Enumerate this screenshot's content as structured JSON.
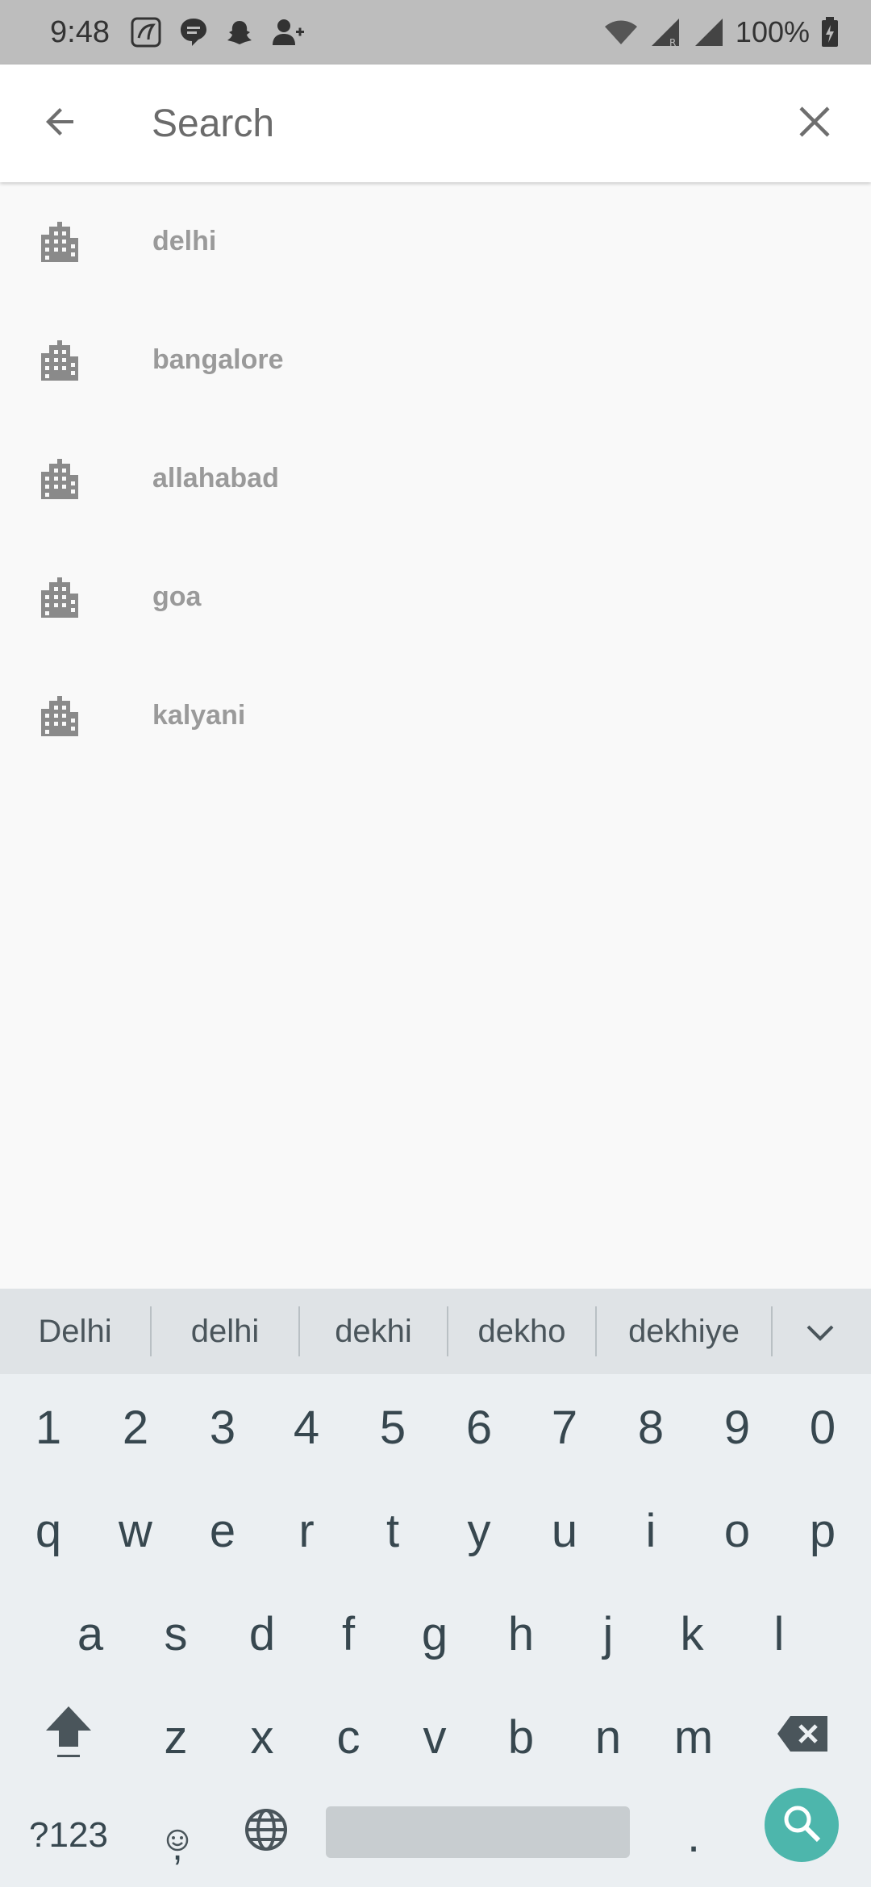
{
  "status_bar": {
    "time": "9:48",
    "battery_text": "100%",
    "left_icons": [
      "saavn-icon",
      "message-icon",
      "snapchat-icon",
      "add-contact-icon"
    ],
    "right_icons": [
      "wifi-icon",
      "signal-roaming-icon",
      "signal-icon",
      "battery-charging-icon"
    ]
  },
  "app_bar": {
    "search_placeholder": "Search",
    "search_value": "",
    "back_icon": "arrow-back-icon",
    "clear_icon": "close-icon"
  },
  "suggestions": [
    {
      "label": "delhi",
      "icon": "city-icon"
    },
    {
      "label": "bangalore",
      "icon": "city-icon"
    },
    {
      "label": "allahabad",
      "icon": "city-icon"
    },
    {
      "label": "goa",
      "icon": "city-icon"
    },
    {
      "label": "kalyani",
      "icon": "city-icon"
    }
  ],
  "keyboard": {
    "word_suggestions": [
      "Delhi",
      "delhi",
      "dekhi",
      "dekho",
      "dekhiye"
    ],
    "number_row": [
      "1",
      "2",
      "3",
      "4",
      "5",
      "6",
      "7",
      "8",
      "9",
      "0"
    ],
    "row1": [
      "q",
      "w",
      "e",
      "r",
      "t",
      "y",
      "u",
      "i",
      "o",
      "p"
    ],
    "row2": [
      "a",
      "s",
      "d",
      "f",
      "g",
      "h",
      "j",
      "k",
      "l"
    ],
    "row3": [
      "z",
      "x",
      "c",
      "v",
      "b",
      "n",
      "m"
    ],
    "symbols_label": "?123",
    "comma_label": ",",
    "period_label": ".",
    "accent_color": "#4db6ac"
  },
  "colors": {
    "status_bar_bg": "#bdbdbd",
    "app_bar_bg": "#ffffff",
    "list_bg": "#f9f9f9",
    "keyboard_bg": "#ebeff2"
  }
}
